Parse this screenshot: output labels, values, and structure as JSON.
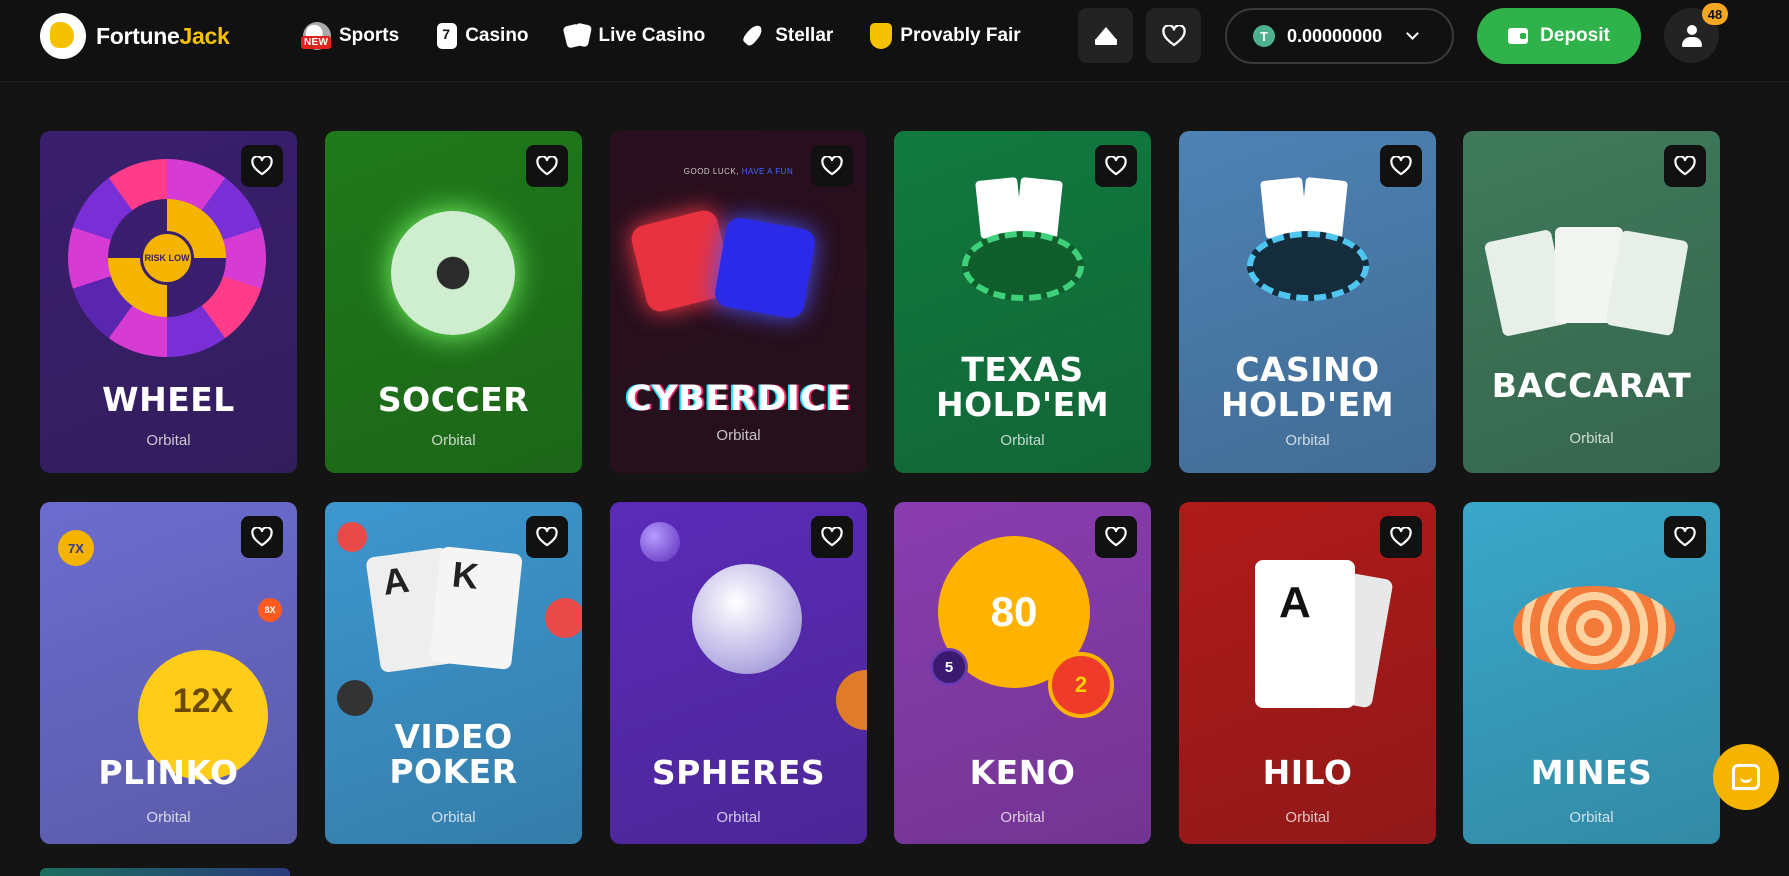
{
  "header": {
    "logo_fortune": "Fortune",
    "logo_jack": "Jack",
    "nav": [
      {
        "label": "Sports",
        "icon": "soccer-ball-icon",
        "badge": "NEW"
      },
      {
        "label": "Casino",
        "icon": "slot-card-icon"
      },
      {
        "label": "Live Casino",
        "icon": "playing-cards-icon"
      },
      {
        "label": "Stellar",
        "icon": "rocket-icon"
      },
      {
        "label": "Provably Fair",
        "icon": "shield-icon"
      }
    ],
    "balance": "0.00000000",
    "currency_symbol": "T",
    "deposit_label": "Deposit",
    "notification_count": "48"
  },
  "games": [
    {
      "title": "WHEEL",
      "provider": "Orbital",
      "bg": "#3a1f6e"
    },
    {
      "title": "SOCCER",
      "provider": "Orbital",
      "bg": "#1f7a1a"
    },
    {
      "title": "CYBERDICE",
      "provider": "Orbital",
      "bg": "#2a0f1e"
    },
    {
      "title": "TEXAS\nHOLD'EM",
      "provider": "Orbital",
      "bg": "#117a3f"
    },
    {
      "title": "CASINO\nHOLD'EM",
      "provider": "Orbital",
      "bg": "#4d82b4"
    },
    {
      "title": "BACCARAT",
      "provider": "Orbital",
      "bg": "#3f7a5c"
    },
    {
      "title": "PLINKO",
      "provider": "Orbital",
      "bg": "#6c6ccf"
    },
    {
      "title": "VIDEO\nPOKER",
      "provider": "Orbital",
      "bg": "#3d97cf"
    },
    {
      "title": "SPHERES",
      "provider": "Orbital",
      "bg": "#5a2bb8"
    },
    {
      "title": "KENO",
      "provider": "Orbital",
      "bg": "#8a3db0"
    },
    {
      "title": "HILO",
      "provider": "Orbital",
      "bg": "#b01a1a"
    },
    {
      "title": "MINES",
      "provider": "Orbital",
      "bg": "#3aa7c9"
    }
  ],
  "art_text": {
    "cyberdice_tagline_a": "GOOD LUCK, ",
    "cyberdice_tagline_b": "HAVE A FUN",
    "wheel_center": "RISK LOW",
    "plinko_multiplier": "12X",
    "plinko_chip_left": "7X",
    "plinko_chip_right": "8X",
    "keno_big": "80",
    "keno_small_left": "5",
    "keno_small_right": "2",
    "poker_card_1": "A",
    "poker_card_2": "K",
    "hilo_card": "A"
  },
  "colors": {
    "deposit_green": "#2fb24a",
    "accent_yellow": "#f5c100",
    "notification_orange": "#f5a623",
    "new_badge_red": "#e2231a"
  }
}
